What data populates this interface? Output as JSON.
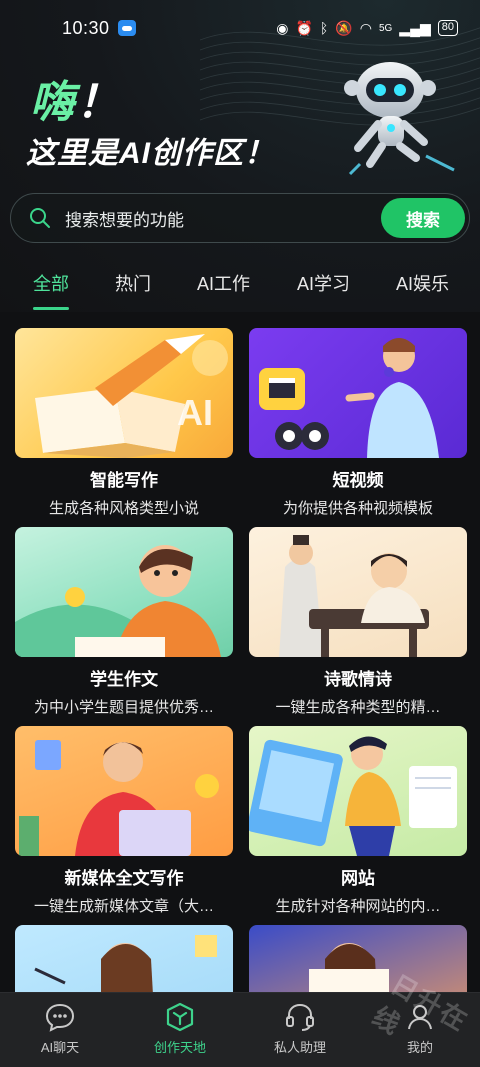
{
  "status_bar": {
    "time": "10:30",
    "network": "5G",
    "battery": "80"
  },
  "hero": {
    "greeting": "嗨",
    "greeting_punct": "！",
    "subtitle": "这里是AI创作区！"
  },
  "search": {
    "placeholder": "搜索想要的功能",
    "button_label": "搜索"
  },
  "tabs": [
    {
      "label": "全部",
      "active": true
    },
    {
      "label": "热门",
      "active": false
    },
    {
      "label": "AI工作",
      "active": false
    },
    {
      "label": "AI学习",
      "active": false
    },
    {
      "label": "AI娱乐",
      "active": false
    }
  ],
  "cards": [
    {
      "title": "智能写作",
      "desc": "生成各种风格类型小说",
      "image_text": "AI"
    },
    {
      "title": "短视频",
      "desc": "为你提供各种视频模板"
    },
    {
      "title": "学生作文",
      "desc": "为中小学生题目提供优秀…"
    },
    {
      "title": "诗歌情诗",
      "desc": "一键生成各种类型的精…"
    },
    {
      "title": "新媒体全文写作",
      "desc": "一键生成新媒体文章（大…"
    },
    {
      "title": "网站",
      "desc": "生成针对各种网站的内…"
    }
  ],
  "bottom_nav": [
    {
      "label": "AI聊天",
      "icon": "chat-bubble-icon",
      "active": false
    },
    {
      "label": "创作天地",
      "icon": "cube-icon",
      "active": true
    },
    {
      "label": "私人助理",
      "icon": "headset-icon",
      "active": false
    },
    {
      "label": "我的",
      "icon": "person-icon",
      "active": false
    }
  ],
  "watermark": "日升在线",
  "colors": {
    "accent": "#20c466",
    "accent_text": "#4fe39b",
    "background": "#111214"
  }
}
